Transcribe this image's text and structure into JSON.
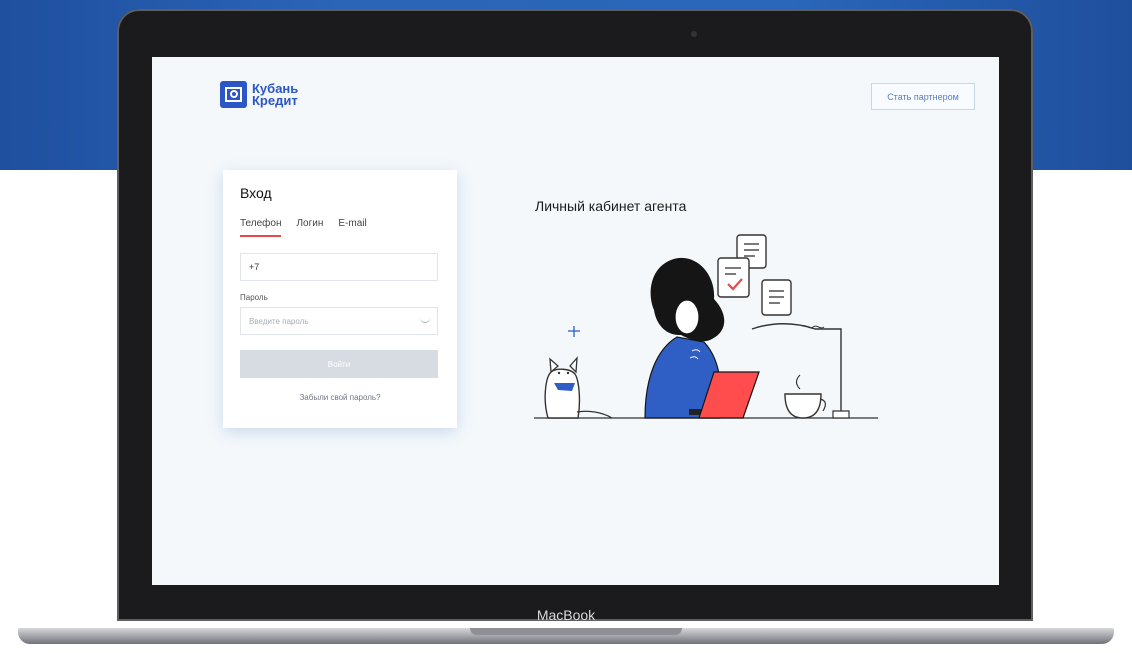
{
  "screen": {
    "brand": {
      "line1": "Кубань",
      "line2": "Кредит"
    },
    "header": {
      "partner_button": "Стать партнером"
    },
    "login": {
      "title": "Вход",
      "tabs": [
        {
          "label": "Телефон",
          "active": true
        },
        {
          "label": "Логин",
          "active": false
        },
        {
          "label": "E-mail",
          "active": false
        }
      ],
      "phone_value": "+7",
      "password_label": "Пароль",
      "password_placeholder": "Введите пароль",
      "submit_label": "Войти",
      "forgot_link": "Забыли свой пароль?"
    },
    "hero": {
      "title": "Личный кабинет агента"
    }
  },
  "device": {
    "label": "MacBook"
  },
  "colors": {
    "brand_blue": "#2a56c6",
    "accent_red": "#e84a4a",
    "illustration_blue": "#2f5fc5",
    "laptop_red": "#ff4d4d"
  }
}
